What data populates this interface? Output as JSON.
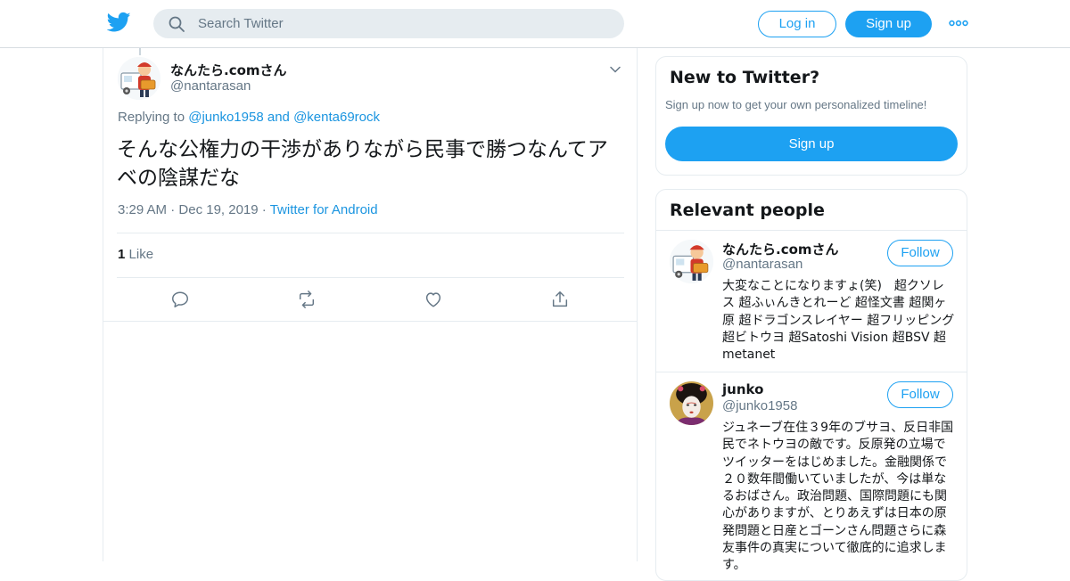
{
  "header": {
    "search_placeholder": "Search Twitter",
    "login_label": "Log in",
    "signup_label": "Sign up",
    "logo_icon": "twitter-bird-icon",
    "more_icon": "more-dots-icon"
  },
  "tweet": {
    "display_name": "なんたら.comさん",
    "handle": "@nantarasan",
    "replying_prefix": "Replying to",
    "replying_user1": "@junko1958",
    "replying_and": "and",
    "replying_user2": "@kenta69rock",
    "text": "そんな公権力の干渉がありながら民事で勝つなんてアベの陰謀だな",
    "time": "3:29 AM",
    "date": "Dec 19, 2019",
    "source": "Twitter for Android",
    "like_count": "1",
    "like_label": "Like",
    "actions": [
      "reply-icon",
      "retweet-icon",
      "like-icon",
      "share-icon"
    ]
  },
  "sidebar": {
    "new_title": "New to Twitter?",
    "new_sub": "Sign up now to get your own personalized timeline!",
    "new_signup_label": "Sign up",
    "relevant_title": "Relevant people",
    "follow_label": "Follow",
    "people": [
      {
        "name": "なんたら.comさん",
        "handle": "@nantarasan",
        "bio": "大変なことになりますょ(笑)　超クソレス 超ふぃんきとれーど 超怪文書 超関ヶ原 超ドラゴンスレイヤー 超フリッピング 超ビトウヨ 超Satoshi Vision 超BSV 超metanet"
      },
      {
        "name": "junko",
        "handle": "@junko1958",
        "bio": "ジュネーブ在住３9年のブサヨ、反日非国民でネトウヨの敵です。反原発の立場でツイッターをはじめました。金融関係で２０数年間働いていましたが、今は単なるおばさん。政治問題、国際問題にも関心がありますが、とりあえずは日本の原発問題と日産とゴーンさん問題さらに森友事件の真実について徹底的に追求します。"
      }
    ]
  },
  "colors": {
    "accent": "#1da1f2",
    "link": "#1b95e0",
    "muted": "#657786"
  }
}
